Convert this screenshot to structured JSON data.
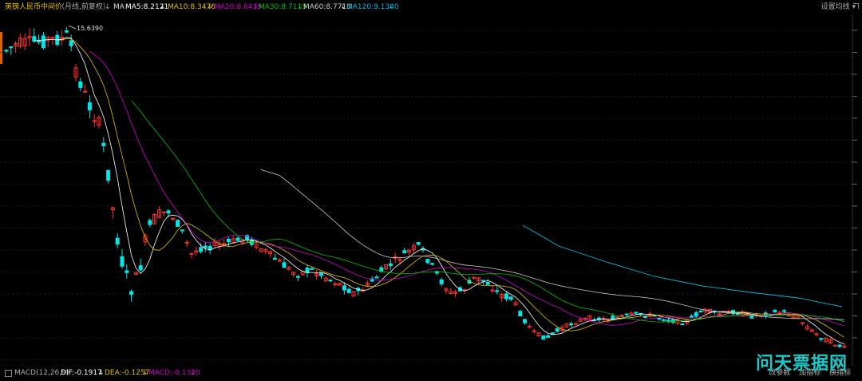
{
  "header": {
    "title": "英镑人民币中间价",
    "period": "（月线,前复权）",
    "ma_label": "MA",
    "ma5": "MA5:8.2121",
    "ma10": "MA10:8.3476",
    "ma20": "MA20:8.6439",
    "ma30": "MA30:8.7119",
    "ma60": "MA60:8.7710",
    "ma120": "MA120:9.1340",
    "arrow": "↓",
    "settings": "设置均线"
  },
  "chart_data": {
    "type": "candlestick",
    "max_annotation": "15.6390",
    "y_range": [
      8.0,
      16.0
    ],
    "colors": {
      "up": "#ff3030",
      "down": "#00e5e5",
      "ma5": "#ffffff",
      "ma10": "#e0c000",
      "ma20": "#d000d0",
      "ma30": "#00c000",
      "ma60": "#c8c8c8",
      "ma120": "#00b8e0"
    }
  },
  "footer": {
    "macd_label": "MACD(12,26,9)",
    "dif": "DIF:-0.1917",
    "dea": "DEA:-0.1257",
    "macd": "MACD:-0.1320",
    "btn_params": "改参数",
    "btn_add": "加指标",
    "btn_switch": "换指标"
  },
  "watermark": "问天票据网"
}
